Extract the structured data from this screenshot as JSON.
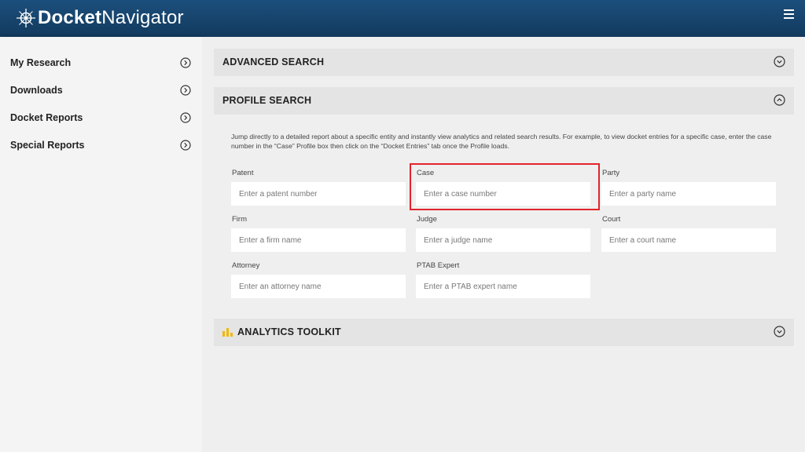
{
  "header": {
    "logo_bold": "Docket",
    "logo_light": "Navigator",
    "logo_icon": "compass-icon",
    "menu_icon": "hamburger-menu-icon"
  },
  "sidebar": {
    "items": [
      {
        "label": "My Research"
      },
      {
        "label": "Downloads"
      },
      {
        "label": "Docket Reports"
      },
      {
        "label": "Special Reports"
      }
    ]
  },
  "panels": {
    "advanced": {
      "title": "ADVANCED SEARCH"
    },
    "profile": {
      "title": "PROFILE SEARCH",
      "description": "Jump directly to a detailed report about a specific entity and instantly view analytics and related search results. For example, to view docket entries for a specific case, enter the case number in the “Case” Profile box then click on the “Docket Entries” tab once the Profile loads.",
      "fields": {
        "patent": {
          "label": "Patent",
          "placeholder": "Enter a patent number",
          "value": ""
        },
        "case": {
          "label": "Case",
          "placeholder": "Enter a case number",
          "value": ""
        },
        "party": {
          "label": "Party",
          "placeholder": "Enter a party name",
          "value": ""
        },
        "firm": {
          "label": "Firm",
          "placeholder": "Enter a firm name",
          "value": ""
        },
        "judge": {
          "label": "Judge",
          "placeholder": "Enter a judge name",
          "value": ""
        },
        "court": {
          "label": "Court",
          "placeholder": "Enter a court name",
          "value": ""
        },
        "attorney": {
          "label": "Attorney",
          "placeholder": "Enter an attorney name",
          "value": ""
        },
        "ptab": {
          "label": "PTAB Expert",
          "placeholder": "Enter a PTAB expert name",
          "value": ""
        }
      }
    },
    "analytics": {
      "title": "ANALYTICS TOOLKIT"
    }
  },
  "colors": {
    "header": "#1c4f7c",
    "highlight": "#e3232c",
    "analytics_icon": "#f2b705"
  }
}
